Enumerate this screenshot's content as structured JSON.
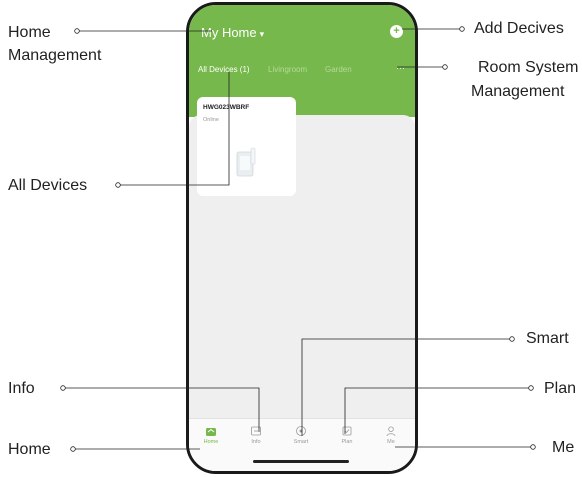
{
  "app": {
    "home_title": "My Home",
    "tabs": [
      "All Devices (1)",
      "Livingroom",
      "Garden"
    ],
    "tab_menu": "···",
    "device": {
      "name": "HWG023WBRF",
      "status": "Online"
    },
    "nav": [
      "Home",
      "Info",
      "Smart",
      "Plan",
      "Me"
    ],
    "accent": "#76b84b"
  },
  "callouts": {
    "home_management_1": "Home",
    "home_management_2": "Management",
    "add_devices": "Add Decives",
    "room_system_1": "Room System",
    "room_system_2": "Management",
    "all_devices": "All Devices",
    "smart": "Smart",
    "info": "Info",
    "plan": "Plan",
    "home": "Home",
    "me": "Me"
  }
}
